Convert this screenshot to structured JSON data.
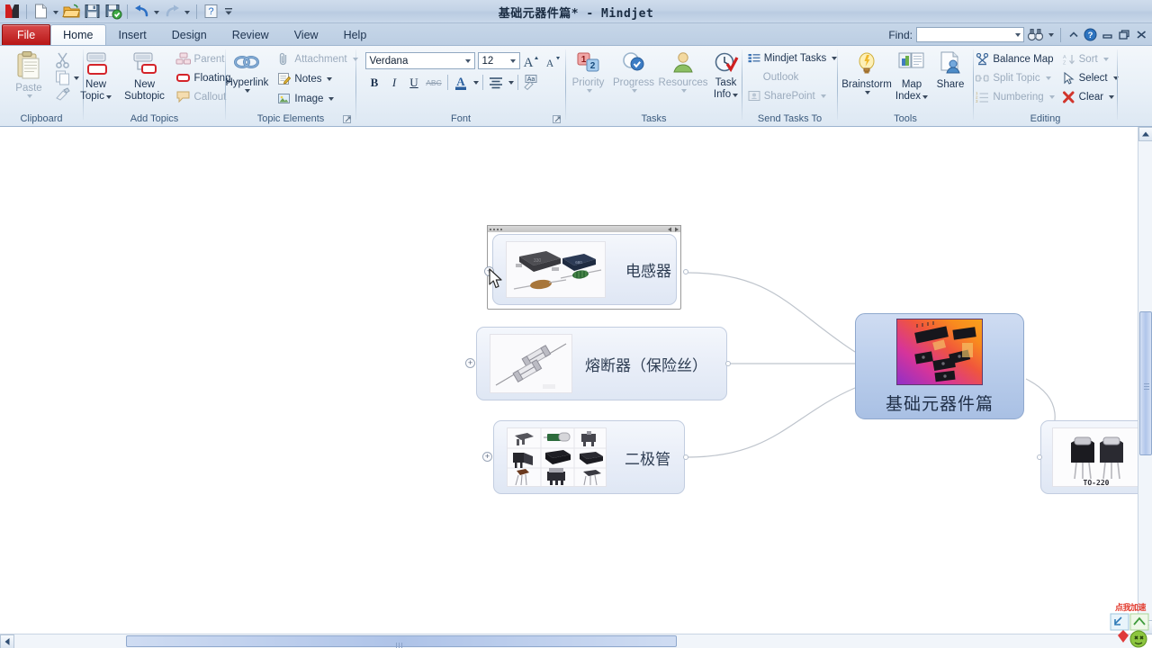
{
  "window": {
    "title": "基础元器件篇* - Mindjet",
    "quick_access": [
      {
        "name": "mindjet-logo-icon",
        "label": "Mindjet"
      },
      {
        "name": "new-document-icon",
        "label": "New"
      },
      {
        "name": "new-dropdown-arrow",
        "label": ""
      },
      {
        "name": "open-folder-icon",
        "label": "Open"
      },
      {
        "name": "save-icon",
        "label": "Save"
      },
      {
        "name": "save-check-icon",
        "label": "Save and Check"
      },
      {
        "name": "undo-icon",
        "label": "Undo"
      },
      {
        "name": "undo-dropdown-arrow",
        "label": ""
      },
      {
        "name": "redo-icon",
        "label": "Redo"
      },
      {
        "name": "redo-dropdown-arrow",
        "label": ""
      },
      {
        "name": "help-icon",
        "label": "Help"
      },
      {
        "name": "customize-qat-arrow",
        "label": ""
      }
    ],
    "controls": {
      "minimize": "Minimize",
      "restore": "Restore",
      "close": "Close"
    }
  },
  "tabs": [
    {
      "label": "File",
      "active": false,
      "kind": "file"
    },
    {
      "label": "Home",
      "active": true,
      "kind": "normal"
    },
    {
      "label": "Insert",
      "active": false,
      "kind": "normal"
    },
    {
      "label": "Design",
      "active": false,
      "kind": "normal"
    },
    {
      "label": "Review",
      "active": false,
      "kind": "normal"
    },
    {
      "label": "View",
      "active": false,
      "kind": "normal"
    },
    {
      "label": "Help",
      "active": false,
      "kind": "normal"
    }
  ],
  "find": {
    "label": "Find:",
    "value": "",
    "placeholder": ""
  },
  "ribbon": {
    "groups": [
      {
        "name": "clipboard",
        "label": "Clipboard",
        "paste": "Paste",
        "cut": "Cut",
        "copy": "Copy",
        "format_painter": "Format Painter"
      },
      {
        "name": "add-topics",
        "label": "Add Topics",
        "new_topic": "New\nTopic",
        "new_topic_l1": "New",
        "new_topic_l2": "Topic",
        "new_subtopic_l1": "New",
        "new_subtopic_l2": "Subtopic",
        "parent": "Parent",
        "floating": "Floating",
        "callout": "Callout"
      },
      {
        "name": "topic-elements",
        "label": "Topic Elements",
        "hyperlink": "Hyperlink",
        "attachment": "Attachment",
        "notes": "Notes",
        "image": "Image"
      },
      {
        "name": "font",
        "label": "Font",
        "font_family": "Verdana",
        "font_size": "12",
        "grow_font": "A",
        "shrink_font": "A",
        "bold": "B",
        "italic": "I",
        "underline": "U",
        "strikethrough": "ABC",
        "font_color": "A",
        "align": "Align",
        "clear_formatting": "Aa"
      },
      {
        "name": "tasks",
        "label": "Tasks",
        "priority": "Priority",
        "progress": "Progress",
        "resources": "Resources",
        "task_info_l1": "Task",
        "task_info_l2": "Info"
      },
      {
        "name": "send-tasks-to",
        "label": "Send Tasks To",
        "mindjet_tasks": "Mindjet Tasks",
        "outlook": "Outlook",
        "sharepoint": "SharePoint"
      },
      {
        "name": "tools",
        "label": "Tools",
        "brainstorm": "Brainstorm",
        "map_index_l1": "Map",
        "map_index_l2": "Index",
        "share": "Share"
      },
      {
        "name": "editing",
        "label": "Editing",
        "balance_map": "Balance Map",
        "split_topic": "Split Topic",
        "numbering": "Numbering",
        "sort": "Sort",
        "select": "Select",
        "clear": "Clear"
      }
    ]
  },
  "map": {
    "central": {
      "label": "基础元器件篇",
      "image_alt": "integrated-circuit-chips-photo"
    },
    "topics": [
      {
        "label": "电感器",
        "image_alt": "inductor-components-photo",
        "selected": true,
        "expander": "+"
      },
      {
        "label": "熔断器（保险丝）",
        "image_alt": "fuse-components-photo",
        "selected": false,
        "expander": "+"
      },
      {
        "label": "二极管",
        "image_alt": "diode-components-grid-photo",
        "selected": false,
        "expander": "+"
      },
      {
        "label": "",
        "image_alt": "to-220-transistor-photo",
        "image_caption": "TO-220",
        "selected": false,
        "expander": ""
      }
    ]
  },
  "overlay": {
    "ad_text": "点我加速"
  },
  "colors": {
    "file_tab": "#b81616",
    "title_bar": "#c3d3e6",
    "ribbon_bg": "#e7eff7",
    "central_node": "#bccfec",
    "node_fill": "#e9eef8",
    "ad_text": "#e23b2e"
  }
}
